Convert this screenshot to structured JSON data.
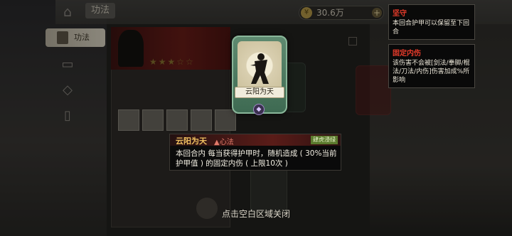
{
  "header": {
    "title": "功法",
    "currency": "30.6万",
    "coin_symbol": "¥",
    "plus_symbol": "+"
  },
  "nav": {
    "tab_label": "功法"
  },
  "card": {
    "name": "云阳为天",
    "gem_symbol": "◆"
  },
  "info": {
    "title": "云阳为天",
    "type": "▲心法",
    "tag": "肆虎浸绿",
    "description": "本回合内 每当获得护甲时，随机造成 ( 30%当前护甲值 ) 的固定内伤 ( 上限10次 )"
  },
  "tooltips": [
    {
      "title": "坚守",
      "body": "本回合护甲可以保留至下回合"
    },
    {
      "title": "固定内伤",
      "body": "该伤害不会被[剑法/拳脚/棍法/刀法/内伤]伤害加成%所影响"
    }
  ],
  "hint": "点击空白区域关闭",
  "colors": {
    "accent_gold": "#f0c060",
    "accent_red": "#e63b2a",
    "card_green": "#5e8a70"
  }
}
